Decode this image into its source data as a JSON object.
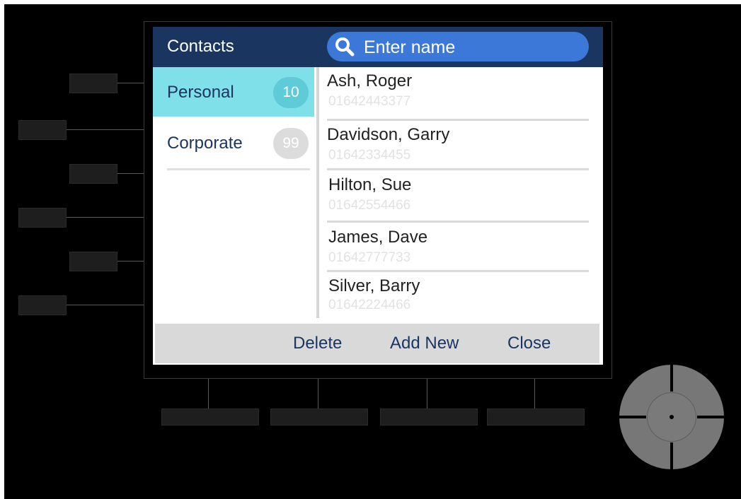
{
  "header": {
    "title": "Contacts",
    "search_placeholder": "Enter name"
  },
  "groups": [
    {
      "label": "Personal",
      "count": "10"
    },
    {
      "label": "Corporate",
      "count": "99"
    }
  ],
  "contacts": [
    {
      "name": "Ash, Roger",
      "phone": "01642443377"
    },
    {
      "name": "Davidson, Garry",
      "phone": "01642334455"
    },
    {
      "name": "Hilton, Sue",
      "phone": "01642554466"
    },
    {
      "name": "James, Dave",
      "phone": "01642777733"
    },
    {
      "name": "Silver, Barry",
      "phone": "01642224466"
    }
  ],
  "footer": {
    "delete_label": "Delete",
    "add_new_label": "Add New",
    "close_label": "Close"
  },
  "colors": {
    "title_bar": "#1a3660",
    "search_pill": "#3c78d8",
    "selected_group": "#7fe0ea",
    "footer_bar": "#d9d9d9"
  }
}
